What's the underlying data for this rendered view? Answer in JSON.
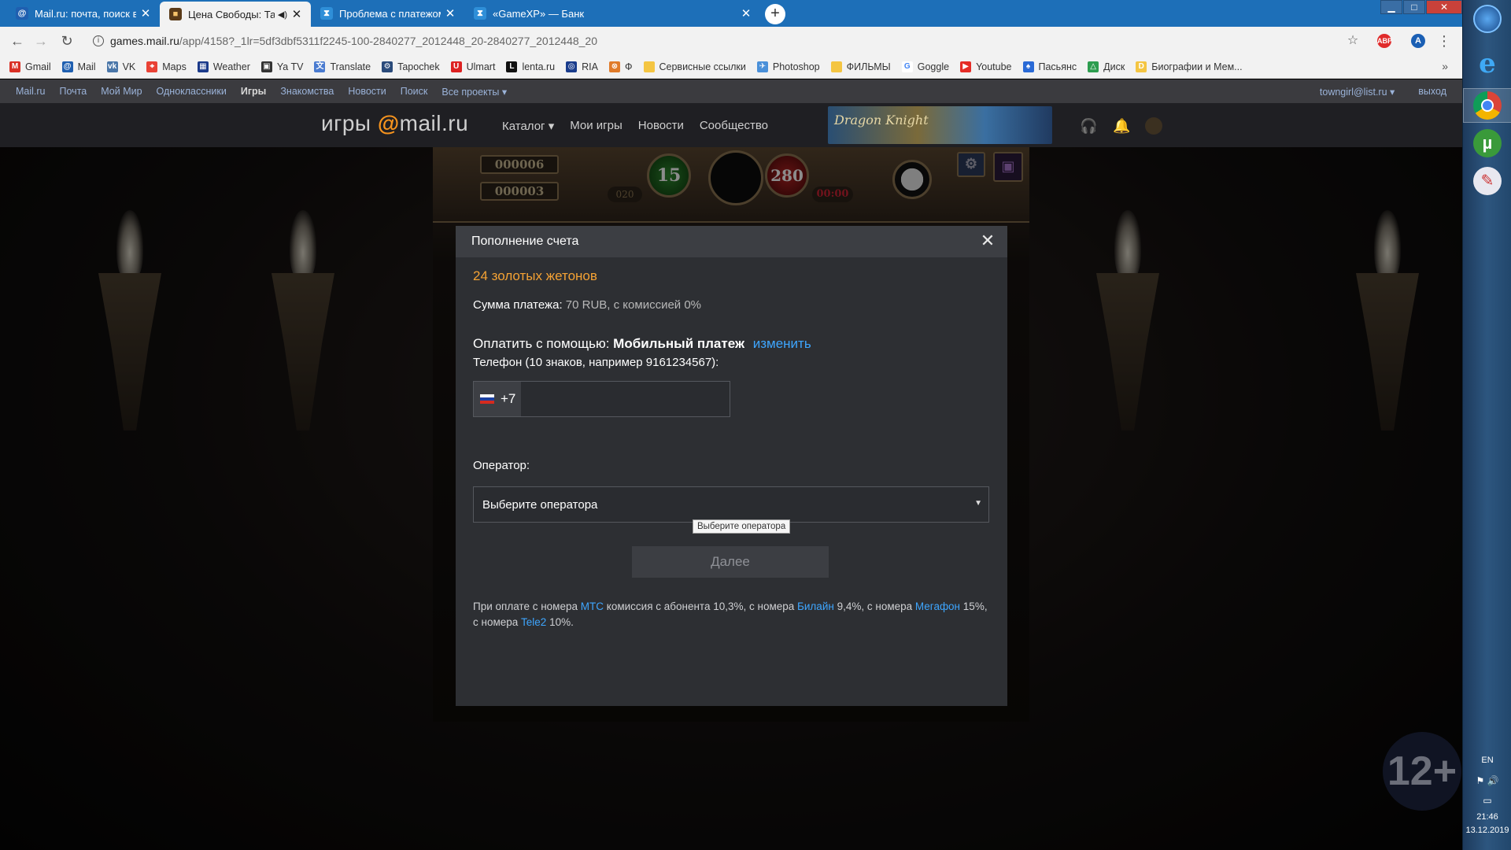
{
  "browser": {
    "tabs": [
      {
        "title": "Mail.ru: почта, поиск в интернете",
        "icon": "mailru-at-icon"
      },
      {
        "title": "Цена Свободы: Тайна Куклы",
        "icon": "game-cube-icon"
      },
      {
        "title": "Проблема с платежом через мобильный",
        "icon": "hourglass-icon"
      },
      {
        "title": "«GameXP» — Банк",
        "icon": "hourglass-icon"
      }
    ],
    "url_host": "games.mail.ru",
    "url_path": "/app/4158?_1lr=5df3dbf5311f2245-100-2840277_2012448_20-2840277_2012448_20",
    "profile_initial": "A",
    "abp_label": "ABP"
  },
  "bookmarks": [
    {
      "label": "Gmail",
      "color": "#d93025",
      "glyph": "M"
    },
    {
      "label": "Mail",
      "color": "#1f5fb0",
      "glyph": "@"
    },
    {
      "label": "VK",
      "color": "#4a76a8",
      "glyph": "vk"
    },
    {
      "label": "Maps",
      "color": "#e94235",
      "glyph": "⌖"
    },
    {
      "label": "Weather",
      "color": "#1b3a8a",
      "glyph": "▦"
    },
    {
      "label": "Ya TV",
      "color": "#333333",
      "glyph": "▣"
    },
    {
      "label": "Translate",
      "color": "#4a7bd0",
      "glyph": "文"
    },
    {
      "label": "Tapochek",
      "color": "#2a4a7a",
      "glyph": "⚙"
    },
    {
      "label": "Ulmart",
      "color": "#d22",
      "glyph": "U"
    },
    {
      "label": "lenta.ru",
      "color": "#111111",
      "glyph": "L"
    },
    {
      "label": "RIA",
      "color": "#1a3c8c",
      "glyph": "◎"
    },
    {
      "label": "Ф",
      "color": "#e07b2a",
      "glyph": "⊗"
    },
    {
      "label": "Сервисные ссылки",
      "color": "#f4c542",
      "glyph": ""
    },
    {
      "label": "Photoshop",
      "color": "#4a90d9",
      "glyph": "✈"
    },
    {
      "label": "ФИЛЬМЫ",
      "color": "#f4c542",
      "glyph": ""
    },
    {
      "label": "Goggle",
      "color": "#ffffff",
      "glyph": "G"
    },
    {
      "label": "Youtube",
      "color": "#e52d27",
      "glyph": "▶"
    },
    {
      "label": "Пасьянс",
      "color": "#2a6ad6",
      "glyph": "♠"
    },
    {
      "label": "Диск",
      "color": "#2d9d4f",
      "glyph": "△"
    },
    {
      "label": "Биографии и Мем...",
      "color": "#f4c542",
      "glyph": "D"
    }
  ],
  "portal": {
    "links": [
      "Mail.ru",
      "Почта",
      "Мой Мир",
      "Одноклассники",
      "Игры",
      "Знакомства",
      "Новости",
      "Поиск",
      "Все проекты ▾"
    ],
    "user": "towngirl@list.ru ▾",
    "logout": "выход"
  },
  "game_header": {
    "logo_text": "игры",
    "logo_at": "@",
    "logo_domain": "mail.ru",
    "nav": [
      "Каталог ▾",
      "Мои игры",
      "Новости",
      "Сообщество"
    ],
    "banner": "Dragon Knight"
  },
  "game_hud": {
    "counter1": "000006",
    "counter2": "000003",
    "green_orb": "15",
    "red_orb": "280",
    "small_left": "020",
    "timer": "00:00",
    "badge12": "12",
    "badge1": "1"
  },
  "modal": {
    "title": "Пополнение счета",
    "tokens": "24 золотых жетонов",
    "sum_label": "Сумма платежа:",
    "sum_value": "70 RUB, с комиссией 0%",
    "pay_label": "Оплатить с помощью:",
    "pay_method": "Мобильный платеж",
    "change_link": "изменить",
    "phone_label": "Телефон (10 знаков, например 9161234567):",
    "phone_prefix": "+7",
    "phone_value": "",
    "operator_label": "Оператор:",
    "operator_value": "Выберите оператора",
    "tooltip": "Выберите оператора",
    "next_button": "Далее",
    "note": {
      "p1": "При оплате с номера",
      "mts": "МТС",
      "p2": "комиссия с абонента 10,3%, с номера",
      "beeline": "Билайн",
      "p3": "9,4%, с номера",
      "megafon": "Мегафон",
      "p4": "15%, с номера",
      "tele2": "Tele2",
      "p5": "10%."
    }
  },
  "age_badge": "12+",
  "taskbar": {
    "lang": "EN",
    "time": "21:46",
    "date": "13.12.2019"
  }
}
